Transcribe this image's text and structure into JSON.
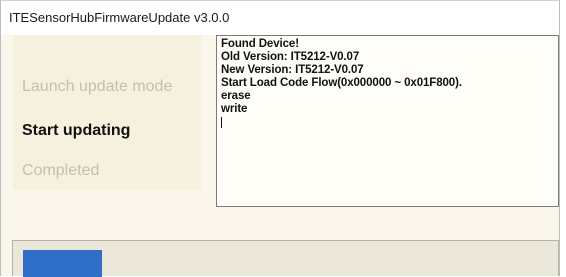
{
  "window": {
    "title": "ITESensorHubFirmwareUpdate v3.0.0"
  },
  "steps": [
    {
      "label": "Launch update mode",
      "state": "completed"
    },
    {
      "label": "Start updating",
      "state": "active"
    },
    {
      "label": "Completed",
      "state": "pending"
    }
  ],
  "log": {
    "lines": [
      "Found Device!",
      "Old Version: IT5212-V0.07",
      "New Version: IT5212-V0.07",
      "Start Load Code Flow(0x000000 ~ 0x01F800).",
      "erase",
      "write"
    ]
  },
  "progress": {
    "fraction": 0.15
  },
  "colors": {
    "client_bg": "#fbf6ec",
    "steps_bg": "#f6f1df",
    "inactive_step": "#c2beb2",
    "active_step": "#111111",
    "progress_fill": "#2f6fc9"
  }
}
